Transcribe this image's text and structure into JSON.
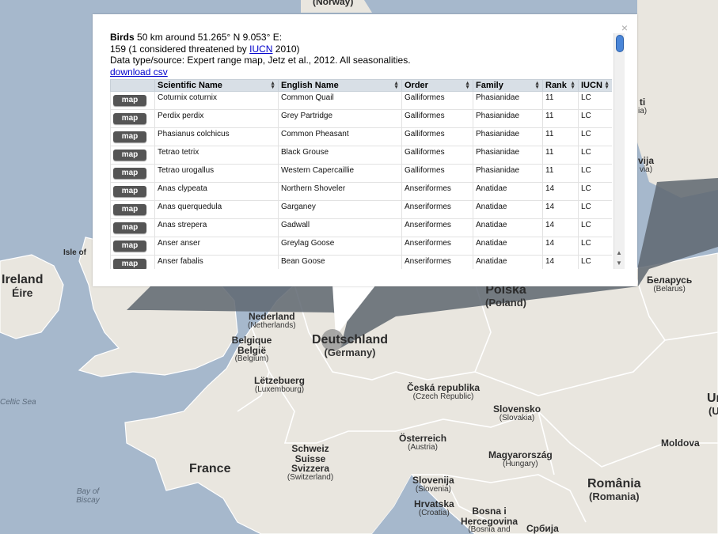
{
  "popup": {
    "title_bold": "Birds",
    "title_rest": " 50 km around 51.265° N 9.053° E:",
    "count_text_before": "159 (1 considered threatened by ",
    "iucn_link": "IUCN",
    "count_text_after": " 2010)",
    "source_text": "Data type/source: Expert range map, Jetz et al., 2012. All seasonalities.",
    "download_link": "download csv",
    "close_glyph": "×",
    "columns": [
      "",
      "Scientific Name",
      "English Name",
      "Order",
      "Family",
      "Rank",
      "IUCN"
    ],
    "map_button_label": "map",
    "rows": [
      {
        "sci": "Coturnix coturnix",
        "eng": "Common Quail",
        "order": "Galliformes",
        "family": "Phasianidae",
        "rank": "11",
        "iucn": "LC"
      },
      {
        "sci": "Perdix perdix",
        "eng": "Grey Partridge",
        "order": "Galliformes",
        "family": "Phasianidae",
        "rank": "11",
        "iucn": "LC"
      },
      {
        "sci": "Phasianus colchicus",
        "eng": "Common Pheasant",
        "order": "Galliformes",
        "family": "Phasianidae",
        "rank": "11",
        "iucn": "LC"
      },
      {
        "sci": "Tetrao tetrix",
        "eng": "Black Grouse",
        "order": "Galliformes",
        "family": "Phasianidae",
        "rank": "11",
        "iucn": "LC"
      },
      {
        "sci": "Tetrao urogallus",
        "eng": "Western Capercaillie",
        "order": "Galliformes",
        "family": "Phasianidae",
        "rank": "11",
        "iucn": "LC"
      },
      {
        "sci": "Anas clypeata",
        "eng": "Northern Shoveler",
        "order": "Anseriformes",
        "family": "Anatidae",
        "rank": "14",
        "iucn": "LC"
      },
      {
        "sci": "Anas querquedula",
        "eng": "Garganey",
        "order": "Anseriformes",
        "family": "Anatidae",
        "rank": "14",
        "iucn": "LC"
      },
      {
        "sci": "Anas strepera",
        "eng": "Gadwall",
        "order": "Anseriformes",
        "family": "Anatidae",
        "rank": "14",
        "iucn": "LC"
      },
      {
        "sci": "Anser anser",
        "eng": "Greylag Goose",
        "order": "Anseriformes",
        "family": "Anatidae",
        "rank": "14",
        "iucn": "LC"
      },
      {
        "sci": "Anser fabalis",
        "eng": "Bean Goose",
        "order": "Anseriformes",
        "family": "Anatidae",
        "rank": "14",
        "iucn": "LC"
      }
    ]
  },
  "map_labels": [
    {
      "id": "norway",
      "name": "(Norway)",
      "sub": ""
    },
    {
      "id": "ireland",
      "name": "Ireland",
      "sub": "Éire"
    },
    {
      "id": "isle-of-man",
      "name": "Isle of",
      "sub": ""
    },
    {
      "id": "netherlands",
      "name": "Nederland",
      "sub": "(Netherlands)"
    },
    {
      "id": "belgium",
      "name": "Belgique België",
      "sub": "(Belgium)"
    },
    {
      "id": "germany",
      "name": "Deutschland",
      "sub": "(Germany)"
    },
    {
      "id": "poland",
      "name": "Polska",
      "sub": "(Poland)"
    },
    {
      "id": "belarus",
      "name": "Беларусь",
      "sub": "(Belarus)"
    },
    {
      "id": "luxembourg",
      "name": "Lëtzebuerg",
      "sub": "(Luxembourg)"
    },
    {
      "id": "czech",
      "name": "Česká republika",
      "sub": "(Czech Republic)"
    },
    {
      "id": "slovakia",
      "name": "Slovensko",
      "sub": "(Slovakia)"
    },
    {
      "id": "austria",
      "name": "Österreich",
      "sub": "(Austria)"
    },
    {
      "id": "switzerland",
      "name": "Schweiz Suisse Svizzera",
      "sub": "(Switzerland)"
    },
    {
      "id": "france",
      "name": "France",
      "sub": ""
    },
    {
      "id": "hungary",
      "name": "Magyarország",
      "sub": "(Hungary)"
    },
    {
      "id": "moldova",
      "name": "Moldova",
      "sub": ""
    },
    {
      "id": "romania",
      "name": "România",
      "sub": "(Romania)"
    },
    {
      "id": "slovenia",
      "name": "Slovenija",
      "sub": "(Slovenia)"
    },
    {
      "id": "croatia",
      "name": "Hrvatska",
      "sub": "(Croatia)"
    },
    {
      "id": "bosnia",
      "name": "Bosna i Hercegovina",
      "sub": "(Bosnia and"
    },
    {
      "id": "serbia",
      "name": "Србија",
      "sub": ""
    },
    {
      "id": "celtic-sea",
      "name": "Celtic Sea",
      "sub": ""
    },
    {
      "id": "bay-of-biscay",
      "name": "Bay of Biscay",
      "sub": ""
    },
    {
      "id": "lithuania-partial",
      "name": "ti",
      "sub": "ia)"
    },
    {
      "id": "latvia-partial",
      "name": "vija",
      "sub": "via)"
    },
    {
      "id": "ukraine-partial",
      "name": "Ur",
      "sub": "(U"
    }
  ],
  "colors": {
    "land": "#e9e6df",
    "water": "#a6b8cc",
    "shadow": "#5e6670",
    "table_header": "#d8dfe6",
    "link": "#0000cc",
    "button": "#555555",
    "marker": "#9a9a9a"
  }
}
